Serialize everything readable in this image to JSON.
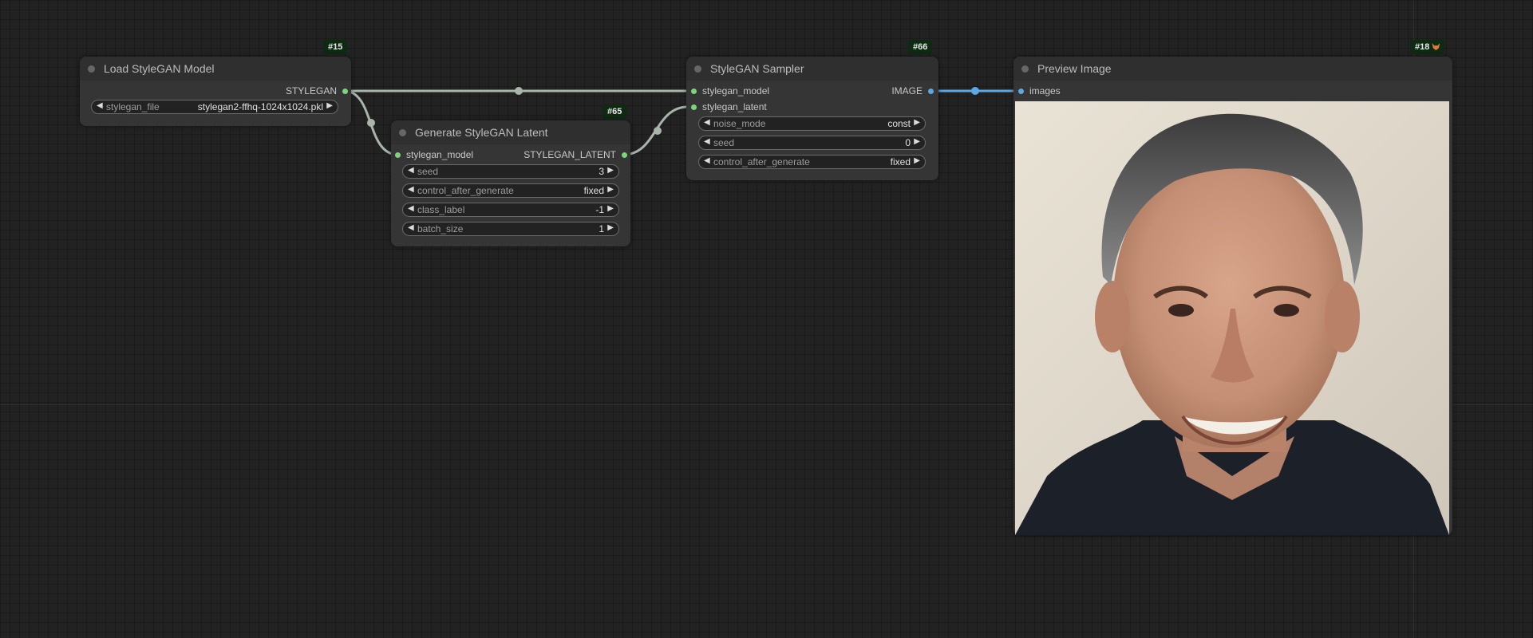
{
  "nodes": {
    "load_model": {
      "id_badge": "#15",
      "title": "Load StyleGAN Model",
      "outputs": [
        "STYLEGAN"
      ],
      "widgets": [
        {
          "label": "stylegan_file",
          "value": "stylegan2-ffhq-1024x1024.pkl"
        }
      ]
    },
    "latent": {
      "id_badge": "#65",
      "title": "Generate StyleGAN Latent",
      "inputs": [
        "stylegan_model"
      ],
      "outputs": [
        "STYLEGAN_LATENT"
      ],
      "widgets": [
        {
          "label": "seed",
          "value": "3"
        },
        {
          "label": "control_after_generate",
          "value": "fixed"
        },
        {
          "label": "class_label",
          "value": "-1"
        },
        {
          "label": "batch_size",
          "value": "1"
        }
      ]
    },
    "sampler": {
      "id_badge": "#66",
      "title": "StyleGAN Sampler",
      "inputs": [
        "stylegan_model",
        "stylegan_latent"
      ],
      "outputs": [
        "IMAGE"
      ],
      "widgets": [
        {
          "label": "noise_mode",
          "value": "const"
        },
        {
          "label": "seed",
          "value": "0"
        },
        {
          "label": "control_after_generate",
          "value": "fixed"
        }
      ]
    },
    "preview": {
      "id_badge": "#18",
      "title": "Preview Image",
      "inputs": [
        "images"
      ]
    }
  },
  "colors": {
    "canvas": "#222222",
    "node_body": "#353535",
    "node_header": "#2f2f2f",
    "pin_green": "#7bd67b",
    "pin_blue": "#5aa8e6",
    "link_gray": "#a9b5a9",
    "link_blue": "#5aa8e6"
  },
  "icons": {
    "widget_left": "◀",
    "widget_right": "▶",
    "preview_badge_icon": "fox-icon"
  }
}
